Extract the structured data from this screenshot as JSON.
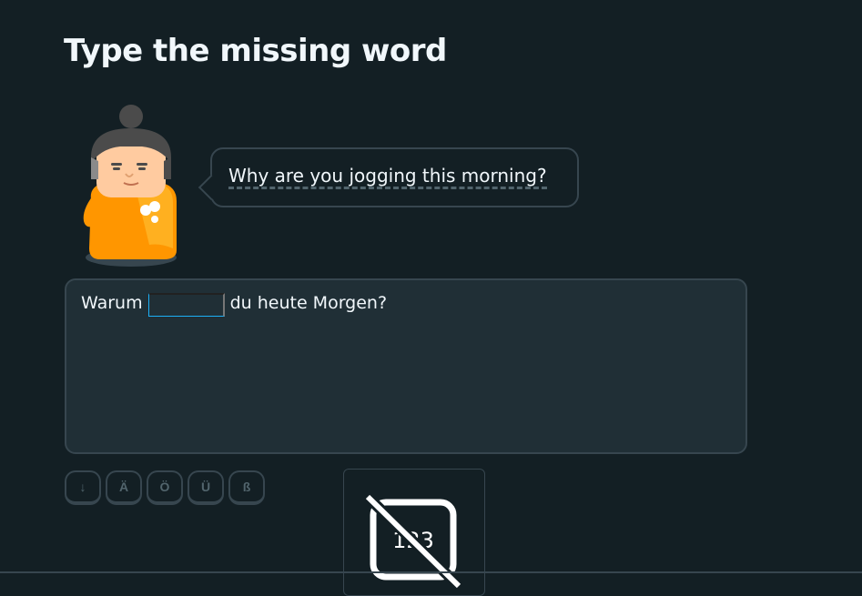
{
  "challenge": {
    "title": "Type the missing word"
  },
  "prompt": {
    "text": "Why are you jogging this morning?"
  },
  "sentence": {
    "before": "Warum",
    "after": "du heute Morgen?",
    "blank_value": ""
  },
  "special_keys": [
    "↓",
    "Ä",
    "Ö",
    "Ü",
    "ß"
  ],
  "keyboard_toggle": {
    "label": "123"
  },
  "colors": {
    "background": "#131f24",
    "border": "#37464f",
    "accent": "#1cb0f6",
    "character_orange": "#ff9600"
  },
  "icons": {
    "character": "lily-character-icon",
    "keyboard": "keyboard-off-icon"
  }
}
